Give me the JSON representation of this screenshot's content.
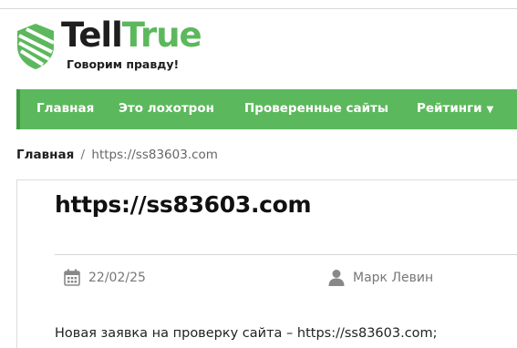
{
  "brand": {
    "name_part1": "Tell",
    "name_part2": "True",
    "tagline": "Говорим правду!",
    "colors": {
      "green": "#5cb85c",
      "dark": "#1e1e1e"
    }
  },
  "nav": {
    "items": [
      {
        "label": "Главная"
      },
      {
        "label": "Это лохотрон"
      },
      {
        "label": "Проверенные сайты"
      },
      {
        "label": "Рейтинги"
      }
    ],
    "dropdown_caret": "▼",
    "background": "#5cb85c"
  },
  "breadcrumb": {
    "home": "Главная",
    "separator": "/",
    "current": "https://ss83603.com"
  },
  "post": {
    "title": "https://ss83603.com",
    "date": "22/02/25",
    "date_icon": "calendar-icon",
    "author": "Марк Левин",
    "author_icon": "user-icon",
    "text": "Новая заявка на проверку сайта – https://ss83603.com;"
  }
}
